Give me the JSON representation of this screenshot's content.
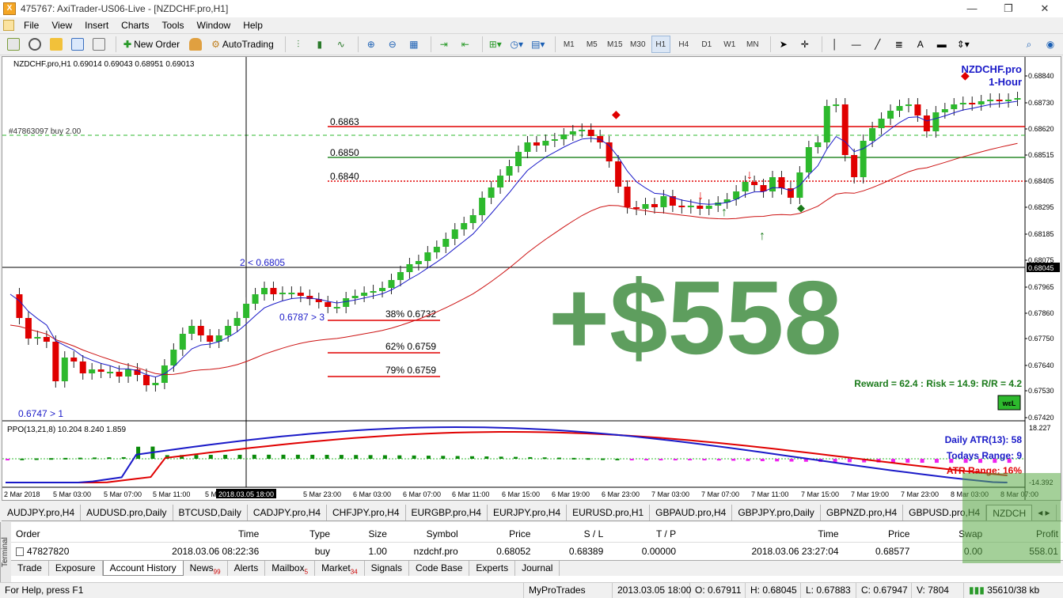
{
  "window": {
    "title": "475767: AxiTrader-US06-Live - [NZDCHF.pro,H1]",
    "buttons": [
      "—",
      "❐",
      "✕"
    ]
  },
  "menu": [
    "File",
    "View",
    "Insert",
    "Charts",
    "Tools",
    "Window",
    "Help"
  ],
  "toolbar": {
    "new_order": "New Order",
    "auto_trading": "AutoTrading",
    "timeframes": [
      "M1",
      "M5",
      "M15",
      "M30",
      "H1",
      "H4",
      "D1",
      "W1",
      "MN"
    ],
    "active_timeframe": "H1"
  },
  "chart": {
    "header": "NZDCHF.pro,H1  0.69014 0.69043 0.68951 0.69013",
    "symbol_label": "NZDCHF.pro",
    "period_label": "1-Hour",
    "order_label": "#47863097 buy 2.00",
    "levels": [
      "0.6863",
      "0.6850",
      "0.6840"
    ],
    "fibs": [
      "38% 0.6732",
      "62% 0.6759",
      "79% 0.6759"
    ],
    "ann_low": "0.6747 > 1",
    "ann_mid": "0.6787 > 3",
    "ann_high": "2 < 0.6805",
    "big_profit": "+$558",
    "reward_text": "Reward = 62.4 : Risk = 14.9: R/R = 4.2",
    "badge": "wεL",
    "price_axis": [
      "0.68840",
      "0.68730",
      "0.68620",
      "0.68515",
      "0.68405",
      "0.68295",
      "0.68185",
      "0.68075",
      "0.68045",
      "0.67965",
      "0.67860",
      "0.67750",
      "0.67640",
      "0.67530",
      "0.67420"
    ],
    "current_price": "0.68045",
    "time_axis": [
      "2 Mar 2018",
      "5 Mar 03:00",
      "5 Mar 07:00",
      "5 Mar 11:00",
      "5 M",
      "5 Mar 23:00",
      "6 Mar 03:00",
      "6 Mar 07:00",
      "6 Mar 11:00",
      "6 Mar 15:00",
      "6 Mar 19:00",
      "6 Mar 23:00",
      "7 Mar 03:00",
      "7 Mar 07:00",
      "7 Mar 11:00",
      "7 Mar 15:00",
      "7 Mar 19:00",
      "7 Mar 23:00",
      "8 Mar 03:00",
      "8 Mar 07:00"
    ],
    "crosshair_time": "2018.03.05 18:00",
    "ppo_header": "PPO(13,21,8) 10.204 8.240 1.859",
    "ppo_axis_top": "18.227",
    "ppo_axis_bottom": "-14.392",
    "daily_atr": "Daily ATR(13): 58",
    "todays_range": "Todays Range: 9",
    "atr_range": "ATR Range: 16%",
    "colors": {
      "up": "#2db92d",
      "down": "#e00000",
      "ma_fast": "#1a1ac8",
      "ma_slow": "#cc1111",
      "big_text": "#5e9e5e"
    }
  },
  "tabs": [
    "AUDJPY.pro,H4",
    "AUDUSD.pro,Daily",
    "BTCUSD,Daily",
    "CADJPY.pro,H4",
    "CHFJPY.pro,H4",
    "EURGBP.pro,H4",
    "EURJPY.pro,H4",
    "EURUSD.pro,H1",
    "GBPAUD.pro,H4",
    "GBPJPY.pro,Daily",
    "GBPNZD.pro,H4",
    "GBPUSD.pro,H4",
    "NZDCH"
  ],
  "active_tab": "NZDCH",
  "terminal": {
    "side_label": "Terminal",
    "columns": [
      "Order",
      "Time",
      "Type",
      "Size",
      "Symbol",
      "Price",
      "S / L",
      "T / P",
      "Time",
      "Price",
      "Swap",
      "Profit"
    ],
    "row": [
      "47827820",
      "2018.03.06 08:22:36",
      "buy",
      "1.00",
      "nzdchf.pro",
      "0.68052",
      "0.68389",
      "0.00000",
      "2018.03.06 23:27:04",
      "0.68577",
      "0.00",
      "558.01"
    ],
    "tabs": [
      {
        "label": "Trade",
        "count": ""
      },
      {
        "label": "Exposure",
        "count": ""
      },
      {
        "label": "Account History",
        "count": ""
      },
      {
        "label": "News",
        "count": "99"
      },
      {
        "label": "Alerts",
        "count": ""
      },
      {
        "label": "Mailbox",
        "count": "5"
      },
      {
        "label": "Market",
        "count": "34"
      },
      {
        "label": "Signals",
        "count": ""
      },
      {
        "label": "Code Base",
        "count": ""
      },
      {
        "label": "Experts",
        "count": ""
      },
      {
        "label": "Journal",
        "count": ""
      }
    ],
    "active_tab": "Account History"
  },
  "status": {
    "help": "For Help, press F1",
    "profile": "MyProTrades",
    "time": "2013.03.05 18:00",
    "open": "O: 0.67911",
    "high": "H: 0.68045",
    "low": "L: 0.67883",
    "close": "C: 0.67947",
    "volume": "V: 7804",
    "traffic": "35610/38 kb"
  }
}
